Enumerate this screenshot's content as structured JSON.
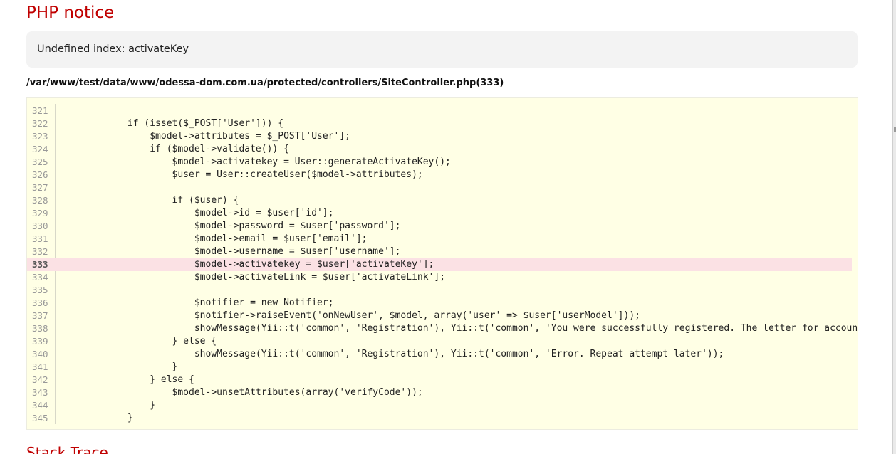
{
  "error": {
    "title": "PHP notice",
    "message": "Undefined index: activateKey",
    "file": "/var/www/test/data/www/odessa-dom.com.ua/protected/controllers/SiteController.php(333)"
  },
  "source": {
    "highlight_line": "333",
    "lines": [
      {
        "num": "321",
        "code": ""
      },
      {
        "num": "322",
        "code": "            if (isset($_POST['User'])) {"
      },
      {
        "num": "323",
        "code": "                $model->attributes = $_POST['User'];"
      },
      {
        "num": "324",
        "code": "                if ($model->validate()) {"
      },
      {
        "num": "325",
        "code": "                    $model->activatekey = User::generateActivateKey();"
      },
      {
        "num": "326",
        "code": "                    $user = User::createUser($model->attributes);"
      },
      {
        "num": "327",
        "code": ""
      },
      {
        "num": "328",
        "code": "                    if ($user) {"
      },
      {
        "num": "329",
        "code": "                        $model->id = $user['id'];"
      },
      {
        "num": "330",
        "code": "                        $model->password = $user['password'];"
      },
      {
        "num": "331",
        "code": "                        $model->email = $user['email'];"
      },
      {
        "num": "332",
        "code": "                        $model->username = $user['username'];"
      },
      {
        "num": "333",
        "code": "                        $model->activatekey = $user['activateKey'];"
      },
      {
        "num": "334",
        "code": "                        $model->activateLink = $user['activateLink'];"
      },
      {
        "num": "335",
        "code": ""
      },
      {
        "num": "336",
        "code": "                        $notifier = new Notifier;"
      },
      {
        "num": "337",
        "code": "                        $notifier->raiseEvent('onNewUser', $model, array('user' => $user['userModel']));"
      },
      {
        "num": "338",
        "code": "                        showMessage(Yii::t('common', 'Registration'), Yii::t('common', 'You were successfully registered. The letter for account a"
      },
      {
        "num": "339",
        "code": "                    } else {"
      },
      {
        "num": "340",
        "code": "                        showMessage(Yii::t('common', 'Registration'), Yii::t('common', 'Error. Repeat attempt later'));"
      },
      {
        "num": "341",
        "code": "                    }"
      },
      {
        "num": "342",
        "code": "                } else {"
      },
      {
        "num": "343",
        "code": "                    $model->unsetAttributes(array('verifyCode'));"
      },
      {
        "num": "344",
        "code": "                }"
      },
      {
        "num": "345",
        "code": "            }"
      }
    ]
  },
  "stack_trace": {
    "title": "Stack Trace"
  },
  "colors": {
    "title": "#c00000",
    "message_bg": "#f3f3f3",
    "code_bg": "#ffffe5",
    "highlight_bg": "#fbe1e4"
  }
}
